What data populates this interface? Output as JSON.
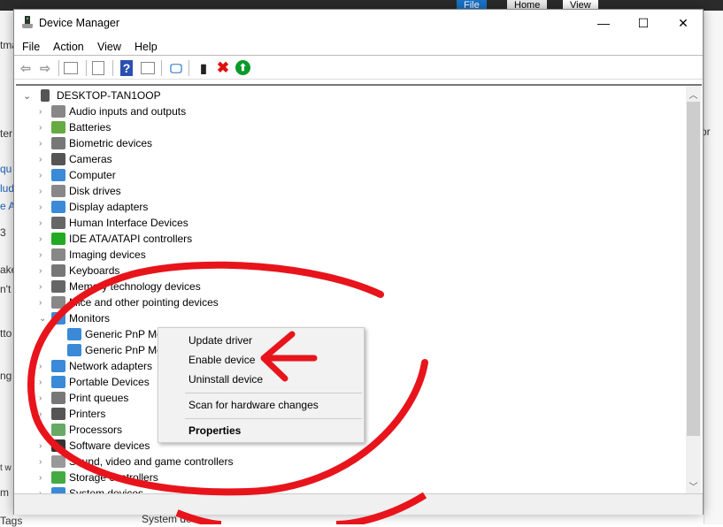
{
  "background": {
    "ribbon_tabs": [
      "File",
      "Home",
      "View"
    ],
    "left_fragments": [
      "tma",
      "ter",
      "qu",
      "lud",
      "e A",
      "3",
      "ake",
      "n't",
      "tto",
      "ng",
      "t w",
      "m",
      "Tags"
    ],
    "right_fragments": [
      "or"
    ],
    "bottom_item": "System dev"
  },
  "window": {
    "title": "Device Manager",
    "controls": {
      "minimize": "—",
      "maximize": "☐",
      "close": "✕"
    }
  },
  "menu": [
    "File",
    "Action",
    "View",
    "Help"
  ],
  "toolbar": [
    "back",
    "forward",
    "show-hide-console-tree",
    "properties",
    "help",
    "action-pane",
    "scan-hardware",
    "update-driver",
    "uninstall",
    "enable"
  ],
  "tree": {
    "root": "DESKTOP-TAN1OOP",
    "items": [
      "Audio inputs and outputs",
      "Batteries",
      "Biometric devices",
      "Cameras",
      "Computer",
      "Disk drives",
      "Display adapters",
      "Human Interface Devices",
      "IDE ATA/ATAPI controllers",
      "Imaging devices",
      "Keyboards",
      "Memory technology devices",
      "Mice and other pointing devices",
      "Monitors",
      "Network adapters",
      "Portable Devices",
      "Print queues",
      "Printers",
      "Processors",
      "Software devices",
      "Sound, video and game controllers",
      "Storage controllers",
      "System devices"
    ],
    "monitors_children": [
      "Generic PnP Monitor",
      "Generic PnP Monitor"
    ]
  },
  "context_menu": {
    "items": [
      "Update driver",
      "Enable device",
      "Uninstall device",
      "Scan for hardware changes",
      "Properties"
    ]
  },
  "colors": {
    "annotation": "#e8141c",
    "remove": "#e01010",
    "enable": "#0a9a2a"
  }
}
